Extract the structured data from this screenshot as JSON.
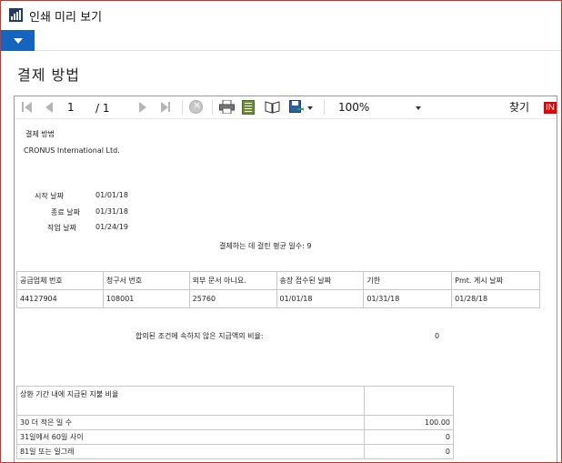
{
  "window": {
    "title": "인쇄 미리 보기"
  },
  "page_title": "결제 방법",
  "toolbar": {
    "current_page": "1",
    "page_total": "/ 1",
    "zoom": "100%",
    "find_label": "찾기",
    "next_label": "IN"
  },
  "report": {
    "title": "결제 방법",
    "company": "CRONUS International Ltd.",
    "start_date_label": "시작 날짜",
    "start_date": "01/01/18",
    "end_date_label": "종료 날짜",
    "end_date": "01/31/18",
    "work_date_label": "작업 날짜",
    "work_date": "01/24/19",
    "avg_days_text": "결제하는 데 걸린 평균 일수: 9",
    "table": {
      "headers": [
        "공급업체 번호",
        "청구서 번호",
        "외부 문서 아니요.",
        "송장 접수된 날짜",
        "기한",
        "Pmt. 게시 날짜"
      ],
      "rows": [
        [
          "44127904",
          "108001",
          "25760",
          "01/01/18",
          "01/31/18",
          "01/28/18"
        ]
      ]
    },
    "noncompliant_label": "합의된 조건에 속하지 않은 지급액의 비율:",
    "noncompliant_value": "0",
    "aging": {
      "header": "상환 기간 내에 지급된 지불 비율",
      "rows": [
        {
          "label": "30 더 적은 일 수",
          "value": "100.00"
        },
        {
          "label": "31일에서 60일 사이",
          "value": "0"
        },
        {
          "label": "81일 또는 일그레",
          "value": "0"
        }
      ]
    }
  }
}
